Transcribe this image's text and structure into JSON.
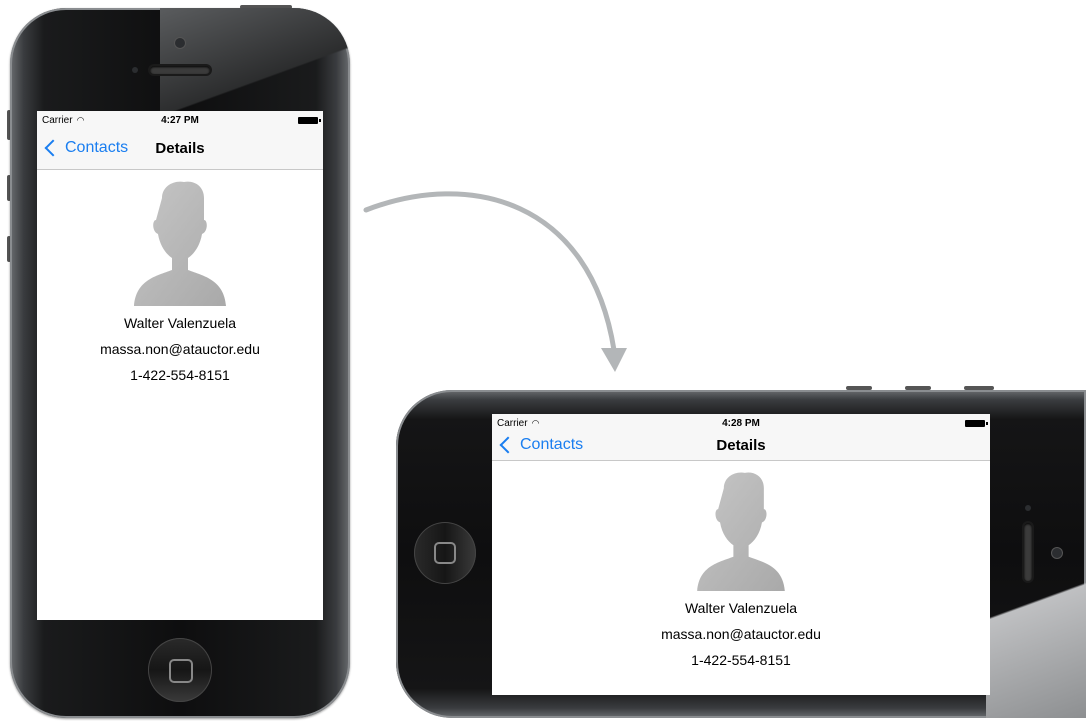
{
  "portrait": {
    "status": {
      "carrier": "Carrier",
      "time": "4:27 PM"
    },
    "nav": {
      "back_label": "Contacts",
      "title": "Details"
    },
    "contact": {
      "name": "Walter Valenzuela",
      "email": "massa.non@atauctor.edu",
      "phone": "1-422-554-8151"
    }
  },
  "landscape": {
    "status": {
      "carrier": "Carrier",
      "time": "4:28 PM"
    },
    "nav": {
      "back_label": "Contacts",
      "title": "Details"
    },
    "contact": {
      "name": "Walter Valenzuela",
      "email": "massa.non@atauctor.edu",
      "phone": "1-422-554-8151"
    }
  },
  "colors": {
    "accent": "#1a7ef0",
    "arrow": "#b3b6b8",
    "avatar": "#b8b8b8"
  },
  "icons": {
    "back": "chevron-left-icon",
    "wifi": "wifi-icon",
    "battery": "battery-icon",
    "avatar": "person-silhouette-icon",
    "home": "home-button-icon",
    "rotation": "curved-arrow-icon"
  }
}
